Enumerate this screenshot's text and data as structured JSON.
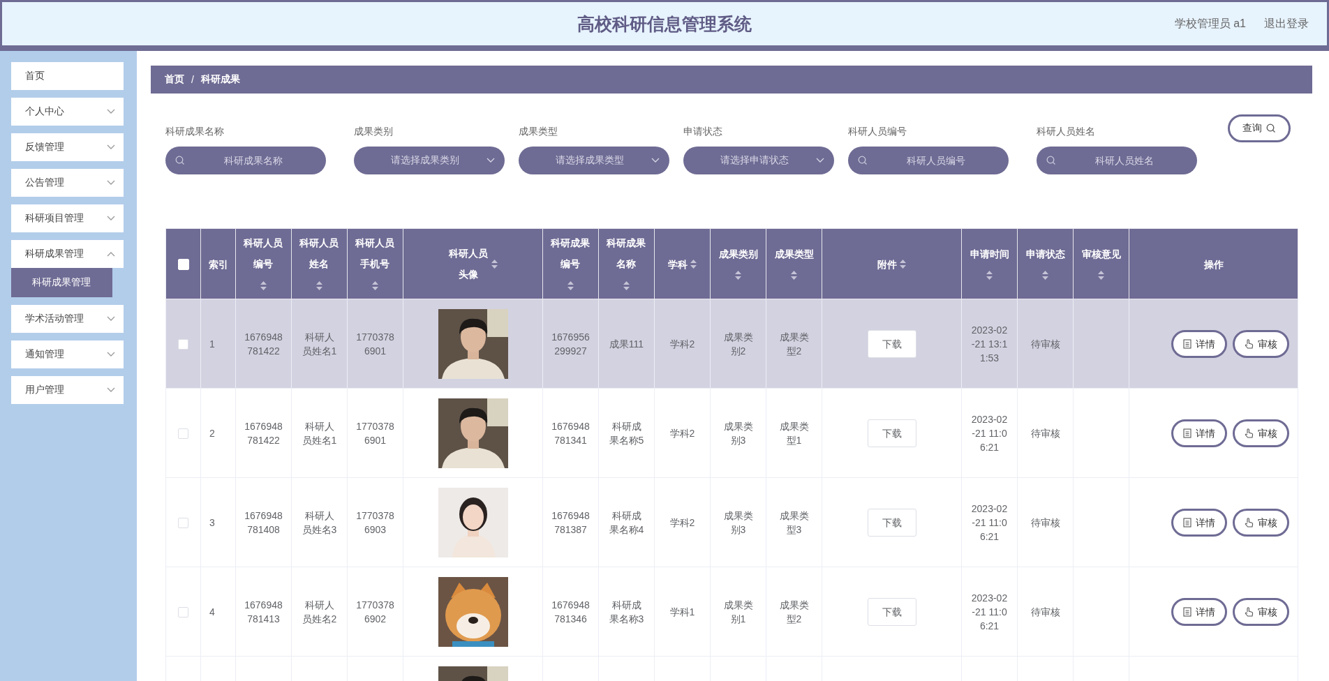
{
  "header": {
    "title": "高校科研信息管理系统",
    "user": "学校管理员 a1",
    "logout": "退出登录"
  },
  "sidebar": {
    "items": [
      {
        "label": "首页",
        "kind": "link"
      },
      {
        "label": "个人中心",
        "kind": "menu",
        "expanded": false
      },
      {
        "label": "反馈管理",
        "kind": "menu",
        "expanded": false
      },
      {
        "label": "公告管理",
        "kind": "menu",
        "expanded": false
      },
      {
        "label": "科研项目管理",
        "kind": "menu",
        "expanded": false
      },
      {
        "label": "科研成果管理",
        "kind": "menu",
        "expanded": true,
        "children": [
          {
            "label": "科研成果管理",
            "selected": true
          }
        ]
      },
      {
        "label": "学术活动管理",
        "kind": "menu",
        "expanded": false
      },
      {
        "label": "通知管理",
        "kind": "menu",
        "expanded": false
      },
      {
        "label": "用户管理",
        "kind": "menu",
        "expanded": false
      }
    ]
  },
  "breadcrumb": {
    "items": [
      "首页",
      "科研成果"
    ],
    "separator": "/"
  },
  "filters": [
    {
      "label": "科研成果名称",
      "kind": "search",
      "placeholder": "科研成果名称"
    },
    {
      "label": "成果类别",
      "kind": "select",
      "placeholder": "请选择成果类别"
    },
    {
      "label": "成果类型",
      "kind": "select",
      "placeholder": "请选择成果类型"
    },
    {
      "label": "申请状态",
      "kind": "select",
      "placeholder": "请选择申请状态"
    },
    {
      "label": "科研人员编号",
      "kind": "search",
      "placeholder": "科研人员编号"
    },
    {
      "label": "科研人员姓名",
      "kind": "search",
      "placeholder": "科研人员姓名"
    }
  ],
  "query_button": "查询",
  "table": {
    "columns": [
      {
        "kind": "checkbox",
        "checked": false
      },
      {
        "label": "索引",
        "sortable": false
      },
      {
        "label": "科研人员编号",
        "sortable": true
      },
      {
        "label": "科研人员姓名",
        "sortable": true
      },
      {
        "label": "科研人员手机号",
        "sortable": true
      },
      {
        "label": "科研人员头像",
        "sortable": true
      },
      {
        "label": "科研成果编号",
        "sortable": true
      },
      {
        "label": "科研成果名称",
        "sortable": true
      },
      {
        "label": "学科",
        "sortable": true
      },
      {
        "label": "成果类别",
        "sortable": true
      },
      {
        "label": "成果类型",
        "sortable": true
      },
      {
        "label": "附件",
        "sortable": true
      },
      {
        "label": "申请时间",
        "sortable": true
      },
      {
        "label": "申请状态",
        "sortable": true
      },
      {
        "label": "审核意见",
        "sortable": true
      },
      {
        "label": "操作",
        "sortable": false
      }
    ],
    "rows": [
      {
        "selected": true,
        "checked": false,
        "index": "1",
        "researcher_id": "1676948781422",
        "researcher_name": "科研人员姓名1",
        "phone": "17703786901",
        "achievement_id": "1676956299927",
        "achievement_name": "成果111",
        "subject": "学科2",
        "category": "成果类别2",
        "type": "成果类型2",
        "attachment": "下载",
        "time": "2023-02-21 13:11:53",
        "status": "待审核",
        "actions": [
          "详情",
          "审核"
        ]
      },
      {
        "selected": false,
        "checked": false,
        "index": "2",
        "researcher_id": "1676948781422",
        "researcher_name": "科研人员姓名1",
        "phone": "17703786901",
        "achievement_id": "1676948781341",
        "achievement_name": "科研成果名称5",
        "subject": "学科2",
        "category": "成果类别3",
        "type": "成果类型1",
        "attachment": "下载",
        "time": "2023-02-21 11:06:21",
        "status": "待审核",
        "actions": [
          "详情",
          "审核"
        ]
      },
      {
        "selected": false,
        "checked": false,
        "index": "3",
        "researcher_id": "1676948781408",
        "researcher_name": "科研人员姓名3",
        "phone": "17703786903",
        "achievement_id": "1676948781387",
        "achievement_name": "科研成果名称4",
        "subject": "学科2",
        "category": "成果类别3",
        "type": "成果类型3",
        "attachment": "下载",
        "time": "2023-02-21 11:06:21",
        "status": "待审核",
        "actions": [
          "详情",
          "审核"
        ]
      },
      {
        "selected": false,
        "checked": false,
        "index": "4",
        "researcher_id": "1676948781413",
        "researcher_name": "科研人员姓名2",
        "phone": "17703786902",
        "achievement_id": "1676948781346",
        "achievement_name": "科研成果名称3",
        "subject": "学科1",
        "category": "成果类别1",
        "type": "成果类型2",
        "attachment": "下载",
        "time": "2023-02-21 11:06:21",
        "status": "待审核",
        "actions": [
          "详情",
          "审核"
        ]
      },
      {
        "selected": false
      }
    ]
  }
}
